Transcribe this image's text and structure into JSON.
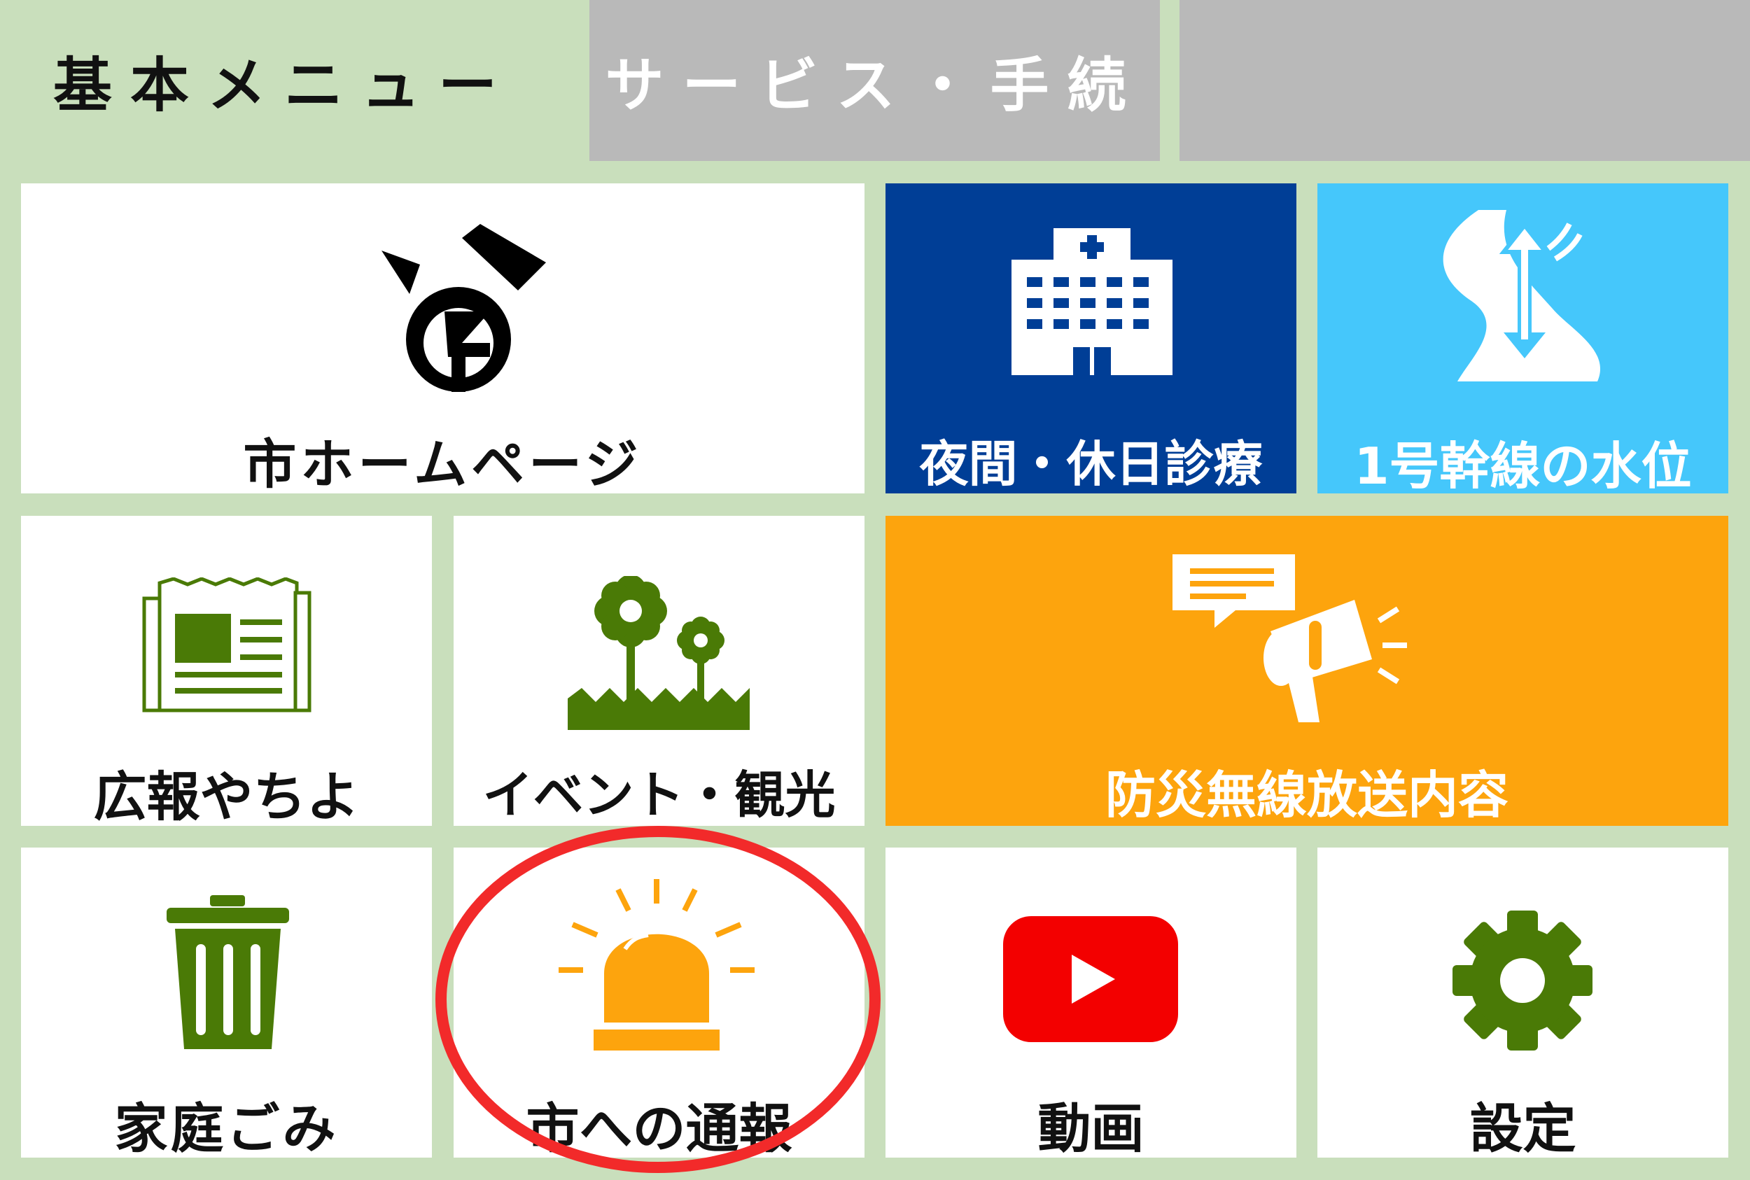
{
  "tabs": [
    {
      "label": "基本メニュー",
      "active": true
    },
    {
      "label": "サービス・手続",
      "active": false
    },
    {
      "label": "",
      "active": false
    }
  ],
  "tiles": {
    "homepage": {
      "label": "市ホームページ",
      "icon": "city-emblem-icon"
    },
    "night_clinic": {
      "label": "夜間・休日診療",
      "icon": "hospital-icon",
      "bg": "#003e96"
    },
    "water_level": {
      "label": "1号幹線の水位",
      "icon": "river-water-level-icon",
      "bg": "#45c7fb"
    },
    "koho": {
      "label": "広報やちよ",
      "icon": "newspaper-icon"
    },
    "events": {
      "label": "イベント・観光",
      "icon": "flowers-icon"
    },
    "bousai": {
      "label": "防災無線放送内容",
      "icon": "megaphone-icon",
      "bg": "#fda40d"
    },
    "garbage": {
      "label": "家庭ごみ",
      "icon": "trash-can-icon"
    },
    "report": {
      "label": "市への通報",
      "icon": "alarm-light-icon"
    },
    "video": {
      "label": "動画",
      "icon": "youtube-play-icon"
    },
    "settings": {
      "label": "設定",
      "icon": "gear-icon"
    }
  },
  "colors": {
    "background": "#c9dfbc",
    "icon_green": "#4a7a06",
    "alarm_orange": "#fda40d",
    "youtube_red": "#f30000",
    "highlight_red": "#f22a2a",
    "navy": "#003e96",
    "sky": "#45c7fb",
    "orange": "#fda40d",
    "tab_inactive": "#b9b9b9"
  }
}
